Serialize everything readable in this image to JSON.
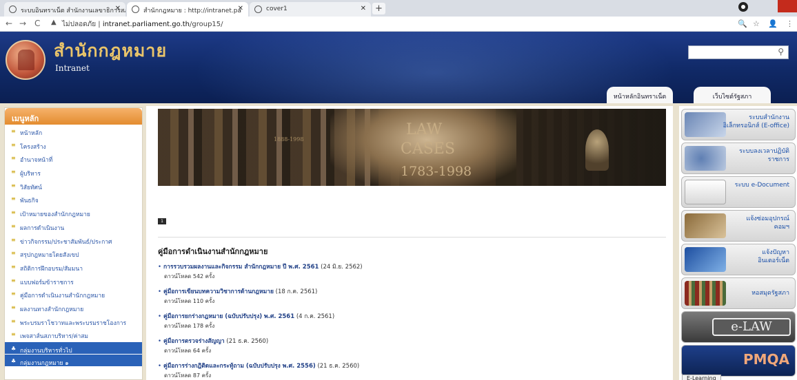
{
  "browser": {
    "tabs": [
      {
        "label": "ระบบอินทราเน็ต สำนักงานเลขาธิการสภา"
      },
      {
        "label": "สำนักกฎหมาย : http://intranet.pa"
      },
      {
        "label": "cover1"
      }
    ],
    "new_tab": "+",
    "back": "←",
    "forward": "→",
    "reload": "C",
    "lock": "▲",
    "insecure_label": "ไม่ปลอดภัย",
    "url_domain": "intranet.parliament.go.th",
    "url_path": "/group15/",
    "zoom_icon": "🔍",
    "star_icon": "☆",
    "profile_icon": "👤",
    "menu_icon": "⋮"
  },
  "header": {
    "title": "สำนักกฎหมาย",
    "subtitle": "Intranet",
    "search_placeholder": "",
    "search_icon": "⚲",
    "tabs": [
      {
        "label": "หน้าหลักอินทราเน็ต"
      },
      {
        "label": "เว็บไซต์รัฐสภา"
      }
    ]
  },
  "sidebar": {
    "header": "เมนูหลัก",
    "bullet": "≡",
    "items": [
      {
        "label": "หน้าหลัก"
      },
      {
        "label": "โครงสร้าง"
      },
      {
        "label": "อำนาจหน้าที่"
      },
      {
        "label": "ผู้บริหาร"
      },
      {
        "label": "วิสัยทัศน์"
      },
      {
        "label": "พันธกิจ"
      },
      {
        "label": "เป้าหมายของสำนักกฎหมาย"
      },
      {
        "label": "ผลการดำเนินงาน"
      },
      {
        "label": "ข่าวกิจกรรม/ประชาสัมพันธ์/ประกาศ"
      },
      {
        "label": "สรุปกฎหมายโดยสังเขป"
      },
      {
        "label": "สถิติการฝึกอบรม/สัมมนา"
      },
      {
        "label": "แบบฟอร์มข้าราชการ"
      },
      {
        "label": "คู่มือการดำเนินงานสำนักกฎหมาย"
      },
      {
        "label": "ผลงานทางสำนักกฎหมาย"
      },
      {
        "label": "พระบรมราโชวาทและพระบรมราชโองการ"
      },
      {
        "label": "เพจสาส์นสภาบริหาร/ค่าสม"
      }
    ],
    "groups": [
      {
        "label": "กลุ่มงานบริหารทั่วไป"
      },
      {
        "label": "กลุ่มงานกฎหมาย ๑"
      }
    ]
  },
  "banner": {
    "line1": "LAW",
    "line2": "CASES",
    "line3": "1783-1998",
    "small": "1888-1998",
    "slide_indicator": "1"
  },
  "main": {
    "section_title": "คู่มือการดำเนินงานสำนักกฎหมาย",
    "bullet": "•",
    "documents": [
      {
        "title": "การรวบรวมผลงานและกิจกรรม สำนักกฎหมาย ปี พ.ศ. 2561",
        "date": "(24 มิ.ย. 2562)",
        "downloads": "ดาวน์โหลด 542 ครั้ง"
      },
      {
        "title": "คู่มือการเขียนบทความวิชาการด้านกฎหมาย",
        "date": "(18 ก.ค. 2561)",
        "downloads": "ดาวน์โหลด 110 ครั้ง"
      },
      {
        "title": "คู่มือการยกร่างกฎหมาย (ฉบับปรับปรุง) พ.ศ. 2561",
        "date": "(4 ก.ค. 2561)",
        "downloads": "ดาวน์โหลด 178 ครั้ง"
      },
      {
        "title": "คู่มือการตรวจร่างสัญญา",
        "date": "(21 ธ.ค. 2560)",
        "downloads": "ดาวน์โหลด 64 ครั้ง"
      },
      {
        "title": "คู่มือการร่างกฎิติดและกระทู้ถาม (ฉบับปรับปรุง พ.ศ. 2556)",
        "date": "(21 ธ.ค. 2560)",
        "downloads": "ดาวน์โหลด 87 ครั้ง"
      }
    ]
  },
  "rightbar": {
    "links": [
      {
        "label": "ระบบสำนักงานอิเล็กทรอนิกส์ (E-office)"
      },
      {
        "label": "ระบบลงเวลาปฏิบัติราชการ"
      },
      {
        "label": "ระบบ e-Document"
      },
      {
        "label": "แจ้งซ่อมอุปกรณ์คอมฯ"
      },
      {
        "label": "แจ้งปัญหาอินเตอร์เน็ต"
      },
      {
        "label": "หอสมุดรัฐสภา"
      },
      {
        "label": "e-LAW"
      },
      {
        "label": "PMQA"
      }
    ],
    "elearning": "E-Learning"
  }
}
